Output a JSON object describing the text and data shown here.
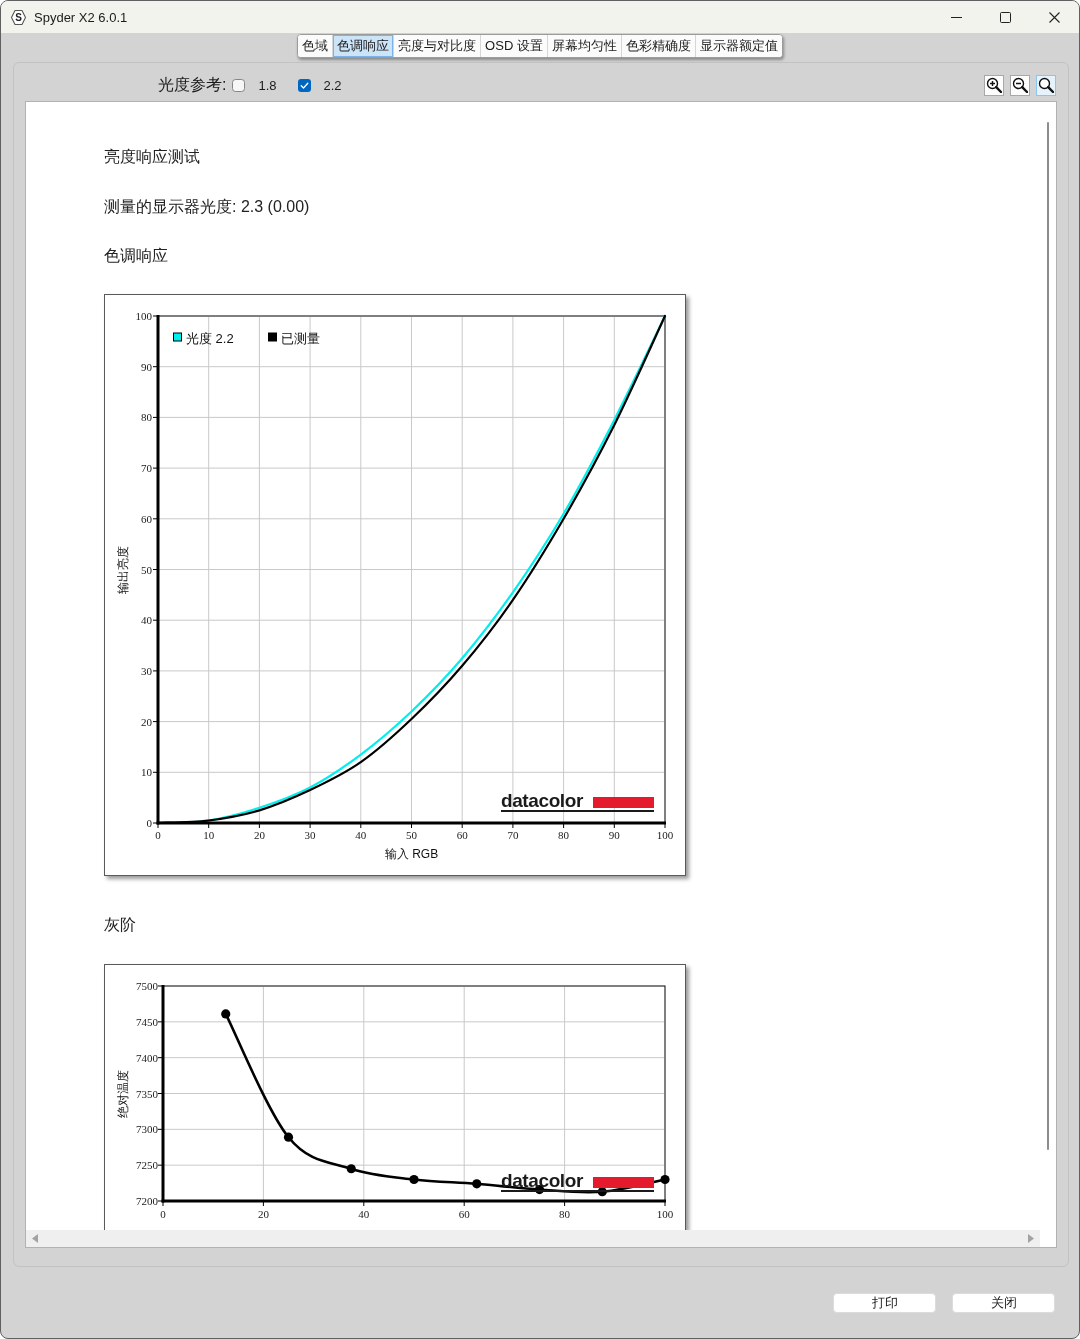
{
  "window": {
    "icon_letter": "S",
    "title": "Spyder X2 6.0.1"
  },
  "tabs": [
    {
      "label": "色域",
      "selected": false
    },
    {
      "label": "色调响应",
      "selected": true
    },
    {
      "label": "亮度与对比度",
      "selected": false
    },
    {
      "label": "OSD 设置",
      "selected": false
    },
    {
      "label": "屏幕均匀性",
      "selected": false
    },
    {
      "label": "色彩精确度",
      "selected": false
    },
    {
      "label": "显示器额定值",
      "selected": false
    }
  ],
  "gamma_reference": {
    "label": "光度参考:",
    "options": [
      {
        "label": "1.8",
        "checked": false
      },
      {
        "label": "2.2",
        "checked": true
      }
    ]
  },
  "zoom_buttons": [
    {
      "kind": "plus",
      "selected": false
    },
    {
      "kind": "minus",
      "selected": false
    },
    {
      "kind": "plain",
      "selected": true
    }
  ],
  "report": {
    "title": "亮度响应测试",
    "measured_gamma": "测量的显示器光度: 2.3 (0.00)",
    "tone_response": {
      "heading": "色调响应",
      "logo": "datacolor",
      "chart_data": {
        "type": "line",
        "xlabel": "输入 RGB",
        "ylabel": "输出亮度",
        "x": [
          0,
          10,
          20,
          30,
          40,
          50,
          60,
          70,
          80,
          90,
          100
        ],
        "series": [
          {
            "name": "光度 2.2",
            "color": "#00eeee",
            "values": [
              0,
              0.5,
              3,
              7,
              13.5,
              22,
              32.5,
              45.5,
              61,
              79.5,
              100
            ]
          },
          {
            "name": "已测量",
            "color": "#000000",
            "values": [
              0,
              0.5,
              2.5,
              6.5,
              12,
              20.5,
              31,
              44,
              60,
              78.5,
              100
            ]
          }
        ],
        "xlim": [
          0,
          100
        ],
        "ylim": [
          0,
          100
        ],
        "xticks": [
          0,
          10,
          20,
          30,
          40,
          50,
          60,
          70,
          80,
          90,
          100
        ],
        "yticks": [
          0,
          10,
          20,
          30,
          40,
          50,
          60,
          70,
          80,
          90,
          100
        ],
        "grid": true,
        "legend": true
      }
    },
    "grayscale": {
      "heading": "灰阶",
      "logo": "datacolor",
      "chart_data": {
        "type": "line",
        "ylabel": "绝对温度",
        "x": [
          12.5,
          25,
          37.5,
          50,
          62.5,
          75,
          87.5,
          100
        ],
        "values": [
          7461,
          7289,
          7245,
          7230,
          7224,
          7216,
          7213,
          7230
        ],
        "xlim": [
          0,
          100
        ],
        "ylim": [
          7200,
          7500
        ],
        "xticks": [
          0,
          20,
          40,
          60,
          80,
          100
        ],
        "yticks": [
          7200,
          7250,
          7300,
          7350,
          7400,
          7450,
          7500
        ],
        "grid": true,
        "marker": "circle"
      }
    }
  },
  "buttons": [
    "打印",
    "关闭"
  ]
}
